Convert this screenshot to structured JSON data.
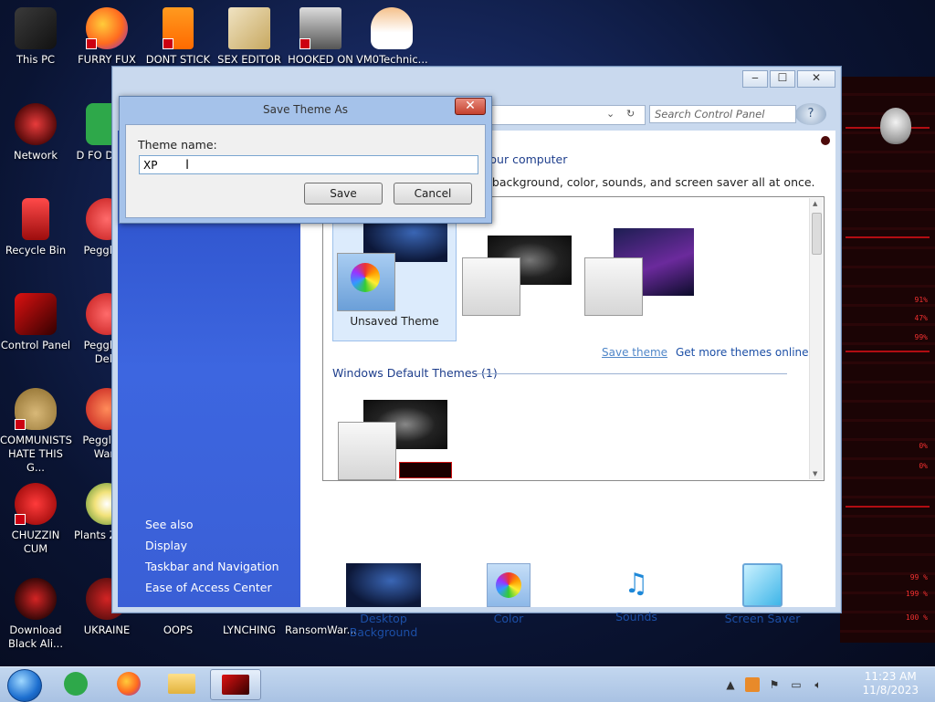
{
  "desktop": {
    "icons": [
      {
        "label": "This PC",
        "icon": "computer-icon"
      },
      {
        "label": "FURRY FUX",
        "icon": "firefox-icon"
      },
      {
        "label": "DONT STICK",
        "icon": "vlc-icon"
      },
      {
        "label": "SEX EDITOR",
        "icon": "hex-editor-icon"
      },
      {
        "label": "HOOKED ON",
        "icon": "game-icon"
      },
      {
        "label": "VM0Technic...",
        "icon": "doctor-icon"
      },
      {
        "label": "Network",
        "icon": "network-icon"
      },
      {
        "label": "D FO DUMB",
        "icon": "app-icon"
      },
      {
        "label": "Recycle Bin",
        "icon": "recycle-bin-icon"
      },
      {
        "label": "Peggle D",
        "icon": "peggle-icon"
      },
      {
        "label": "Control Panel",
        "icon": "control-panel-icon"
      },
      {
        "label": "Peggle N Delu",
        "icon": "peggle-icon"
      },
      {
        "label": "COMMUNISTS HATE THIS G...",
        "icon": "money-bag-icon"
      },
      {
        "label": "Peggle of Warc",
        "icon": "peggle-icon"
      },
      {
        "label": "CHUZZIN CUM",
        "icon": "chuzzle-icon"
      },
      {
        "label": "Plants Zomb",
        "icon": "plants-icon"
      },
      {
        "label": "Download Black Ali...",
        "icon": "alien-icon"
      },
      {
        "label": "UKRAINE",
        "icon": "app-icon"
      },
      {
        "label": "OOPS",
        "icon": "app-icon"
      },
      {
        "label": "LYNCHING",
        "icon": "app-icon"
      },
      {
        "label": "RansomWar...",
        "icon": "app-icon"
      }
    ],
    "hud_values": [
      "91%",
      "47%",
      "99%",
      "0%",
      "0%",
      "99 %",
      "199 %",
      "100 %"
    ]
  },
  "window": {
    "buttons": {
      "minimize": "‒",
      "maximize": "☐",
      "close": "✕"
    },
    "search_placeholder": "Search Control Panel",
    "heading": "your computer",
    "description": "p background, color, sounds, and screen saver all at once.",
    "see_also": {
      "title": "See also",
      "items": [
        "Display",
        "Taskbar and Navigation",
        "Ease of Access Center"
      ]
    },
    "themes": {
      "my_themes": [
        {
          "name": "Unsaved Theme",
          "selected": true
        },
        {
          "name": "",
          "selected": false
        },
        {
          "name": "",
          "selected": false
        }
      ],
      "save_theme_link": "Save theme",
      "get_more_link": "Get more themes online",
      "default_section": "Windows Default Themes (1)"
    },
    "bottom": [
      {
        "label": "Desktop Background",
        "icon": "desktop-background-icon"
      },
      {
        "label": "Color",
        "icon": "color-icon"
      },
      {
        "label": "Sounds",
        "icon": "sounds-icon"
      },
      {
        "label": "Screen Saver",
        "icon": "screen-saver-icon"
      }
    ]
  },
  "dialog": {
    "title": "Save Theme As",
    "close": "✕",
    "field_label": "Theme name:",
    "field_value": "XP",
    "save": "Save",
    "cancel": "Cancel"
  },
  "taskbar": {
    "time": "11:23 AM",
    "date": "11/8/2023"
  },
  "colors": {
    "accent_blue": "#1c4fa6",
    "left_pane": "#3d66e0",
    "selected_theme": "#dcebfc"
  }
}
